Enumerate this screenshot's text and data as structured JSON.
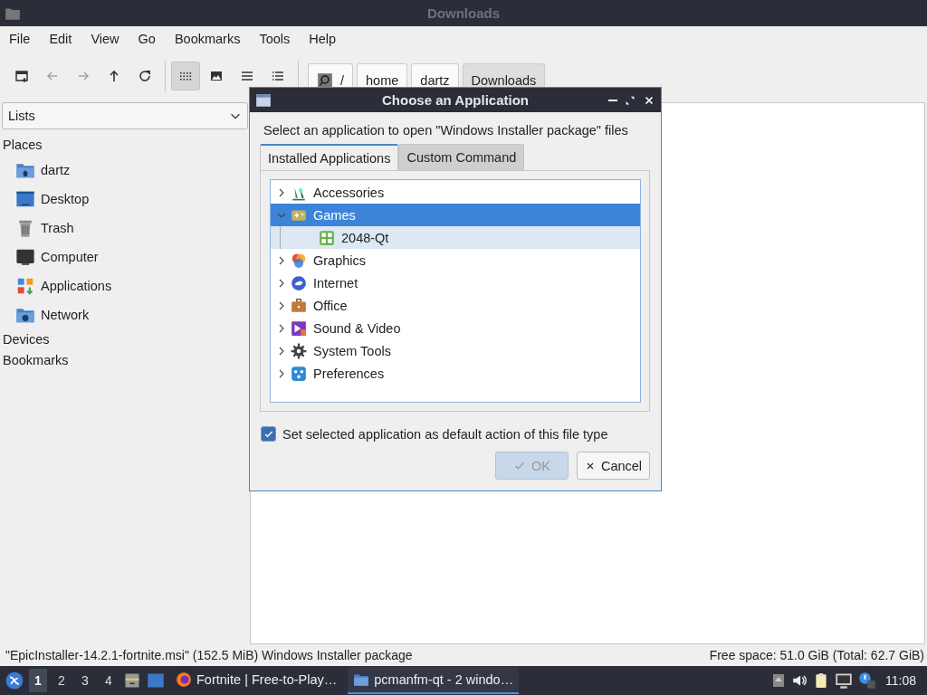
{
  "window": {
    "title": "Downloads"
  },
  "menu": [
    "File",
    "Edit",
    "View",
    "Go",
    "Bookmarks",
    "Tools",
    "Help"
  ],
  "nav_buttons": [
    {
      "kind": "new-tab",
      "disabled": false
    },
    {
      "kind": "back",
      "disabled": true
    },
    {
      "kind": "forward",
      "disabled": true
    },
    {
      "kind": "up",
      "disabled": false
    },
    {
      "kind": "reload",
      "disabled": false
    }
  ],
  "view_buttons": [
    {
      "kind": "icons",
      "selected": true
    },
    {
      "kind": "thumbnails",
      "selected": false
    },
    {
      "kind": "compact",
      "selected": false
    },
    {
      "kind": "details",
      "selected": false
    }
  ],
  "path": [
    {
      "kind": "root",
      "label": "/",
      "selected": false
    },
    {
      "kind": "dir",
      "label": "home",
      "selected": false
    },
    {
      "kind": "dir",
      "label": "dartz",
      "selected": false
    },
    {
      "kind": "dir",
      "label": "Downloads",
      "selected": true
    }
  ],
  "sidebar": {
    "dropdown": "Lists",
    "sections": [
      {
        "title": "Places",
        "items": [
          {
            "kind": "home",
            "label": "dartz"
          },
          {
            "kind": "desktop",
            "label": "Desktop"
          },
          {
            "kind": "trash",
            "label": "Trash"
          },
          {
            "kind": "computer",
            "label": "Computer"
          },
          {
            "kind": "apps",
            "label": "Applications"
          },
          {
            "kind": "network",
            "label": "Network"
          }
        ]
      },
      {
        "title": "Devices"
      },
      {
        "title": "Bookmarks"
      }
    ]
  },
  "status_bar": {
    "left": "\"EpicInstaller-14.2.1-fortnite.msi\" (152.5 MiB) Windows Installer package",
    "right": "Free space: 51.0 GiB (Total: 62.7 GiB)"
  },
  "taskbar": {
    "desktops": [
      {
        "label": "1",
        "selected": true
      },
      {
        "label": "2",
        "selected": false
      },
      {
        "label": "3",
        "selected": false
      },
      {
        "label": "4",
        "selected": false
      }
    ],
    "tasks": [
      {
        "kind": "browser",
        "label": "Fortnite | Free-to-Play…",
        "selected": false
      },
      {
        "kind": "folder",
        "label": "pcmanfm-qt - 2 windo…",
        "selected": true
      }
    ],
    "clock": "11:08"
  },
  "dialog": {
    "title": "Choose an Application",
    "prompt": "Select an application to open \"Windows Installer package\" files",
    "tabs": [
      {
        "label": "Installed Applications",
        "selected": true
      },
      {
        "label": "Custom Command",
        "selected": false
      }
    ],
    "tree": [
      {
        "kind": "accessories",
        "label": "Accessories",
        "expanded": false,
        "selected": false,
        "hovered": false
      },
      {
        "kind": "games",
        "label": "Games",
        "expanded": true,
        "selected": true,
        "hovered": false,
        "children": [
          {
            "kind": "tiles",
            "label": "2048-Qt",
            "selected": false,
            "hovered": true
          }
        ]
      },
      {
        "kind": "graphics",
        "label": "Graphics",
        "expanded": false,
        "selected": false,
        "hovered": false
      },
      {
        "kind": "internet",
        "label": "Internet",
        "expanded": false,
        "selected": false,
        "hovered": false
      },
      {
        "kind": "office",
        "label": "Office",
        "expanded": false,
        "selected": false,
        "hovered": false
      },
      {
        "kind": "media",
        "label": "Sound & Video",
        "expanded": false,
        "selected": false,
        "hovered": false
      },
      {
        "kind": "system",
        "label": "System Tools",
        "expanded": false,
        "selected": false,
        "hovered": false
      },
      {
        "kind": "prefs",
        "label": "Preferences",
        "expanded": false,
        "selected": false,
        "hovered": false
      }
    ],
    "default_checkbox": {
      "label": "Set selected application as default action of this file type",
      "checked": true
    },
    "buttons": [
      {
        "kind": "ok",
        "label": "OK",
        "disabled": true
      },
      {
        "kind": "cancel",
        "label": "Cancel",
        "disabled": false
      }
    ]
  }
}
